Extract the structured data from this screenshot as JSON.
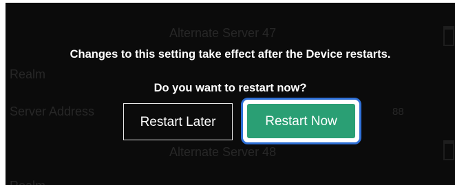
{
  "background": {
    "header_47": "Alternate Server 47",
    "realm_label": "Realm",
    "server_address_label": "Server Address",
    "port_value": "88",
    "header_48": "Alternate Server 48",
    "bottom_label": "Realm"
  },
  "dialog": {
    "message": "Changes to this setting take effect after the Device restarts.",
    "question": "Do you want to restart now?",
    "restart_later_label": "Restart Later",
    "restart_now_label": "Restart Now"
  },
  "colors": {
    "overlay": "#0b0b0b",
    "primary_button": "#2a9f74",
    "focus_ring": "#2e6fd6"
  }
}
